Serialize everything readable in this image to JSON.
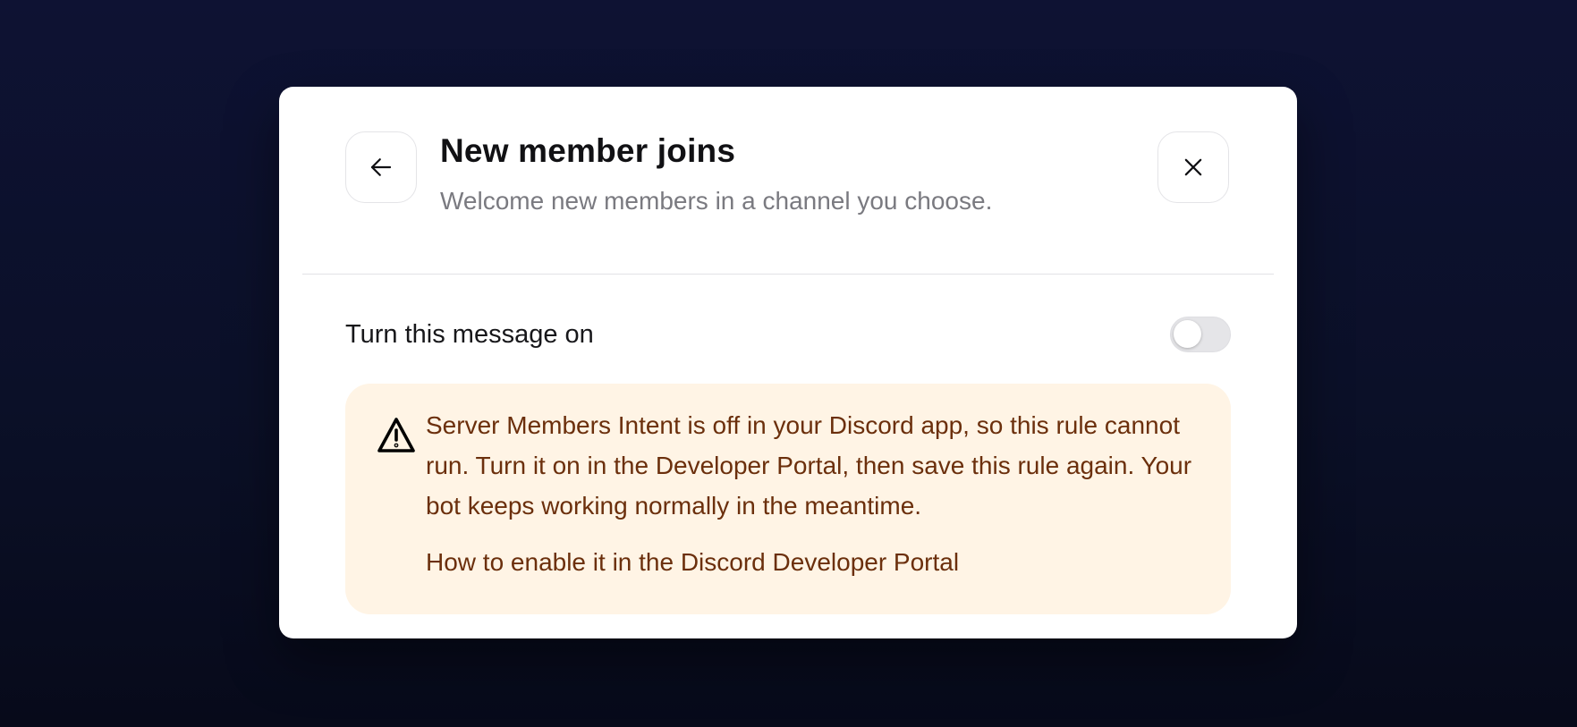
{
  "dialog": {
    "title": "New member joins",
    "subtitle": "Welcome new members in a channel you choose.",
    "back_icon": "arrow-left-icon",
    "close_icon": "close-icon"
  },
  "toggle": {
    "label": "Turn this message on",
    "enabled": false
  },
  "warning": {
    "icon": "warning-triangle-icon",
    "message": "Server Members Intent is off in your Discord app, so this rule cannot run. Turn it on in the Developer Portal, then save this rule again. Your bot keeps working normally in the meantime.",
    "link_text": "How to enable it in the Discord Developer Portal"
  },
  "colors": {
    "overlay_background": "#0e1233",
    "modal_background": "#ffffff",
    "warning_background": "#fff4e5",
    "warning_text": "#6b2f0c",
    "toggle_off": "#e5e5e8"
  }
}
